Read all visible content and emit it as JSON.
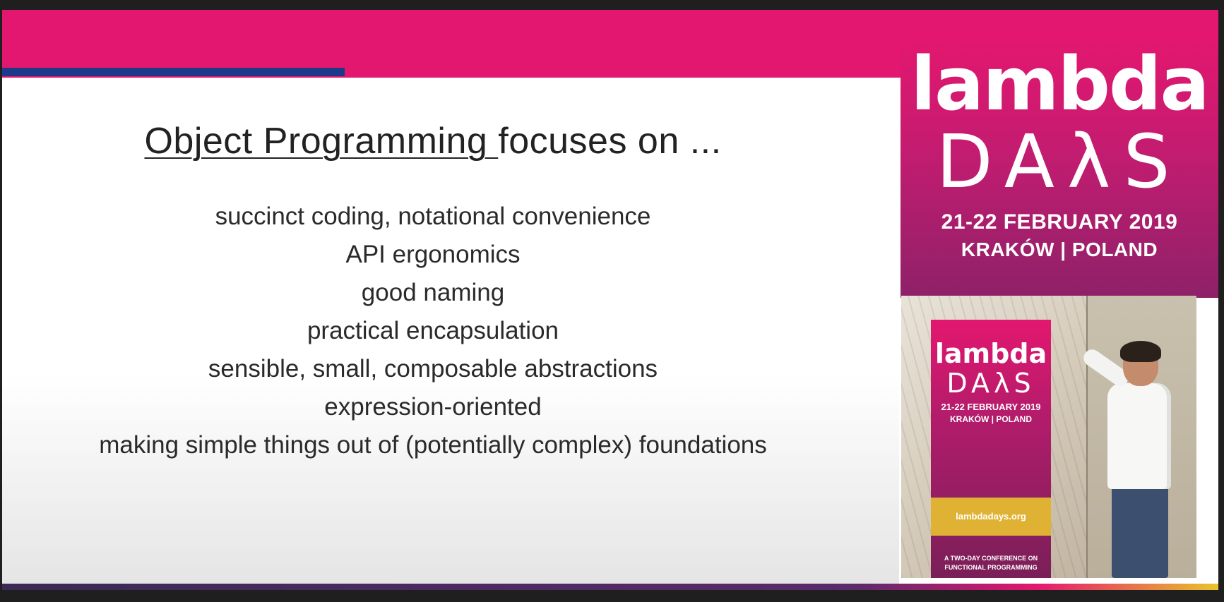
{
  "slide": {
    "title_underlined": "Object Programming ",
    "title_rest": "focuses on ...",
    "points": [
      "succinct coding, notational convenience",
      "API ergonomics",
      "good naming",
      "practical encapsulation",
      "sensible, small, composable abstractions",
      "expression-oriented",
      "making simple things out of (potentially complex) foundations"
    ]
  },
  "logo": {
    "word": "lambda",
    "days": "DAλS",
    "dates": "21-22 FEBRUARY 2019",
    "place": "KRAKÓW | POLAND"
  },
  "video_banner": {
    "word": "lambda",
    "days": "DAλS",
    "dates": "21-22 FEBRUARY 2019",
    "place": "KRAKÓW | POLAND",
    "url": "lambdadays.org",
    "tagline": "A TWO-DAY CONFERENCE ON FUNCTIONAL PROGRAMMING"
  },
  "colors": {
    "brand_pink": "#e3176f",
    "accent_blue": "#1d3a8a",
    "banner_yellow": "#e0b233"
  }
}
